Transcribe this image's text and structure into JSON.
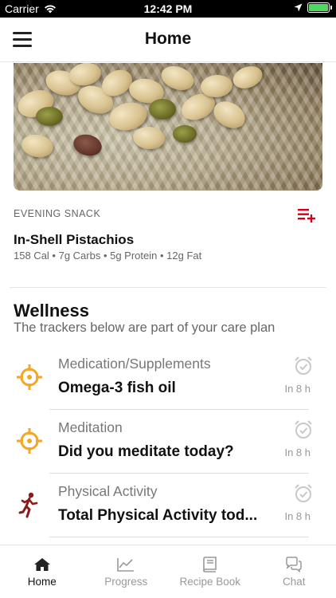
{
  "status_bar": {
    "carrier": "Carrier",
    "time": "12:42 PM",
    "battery_level": 1.0
  },
  "nav": {
    "title": "Home",
    "menu_icon": "hamburger-menu-icon"
  },
  "meal": {
    "type": "EVENING SNACK",
    "name": "In-Shell Pistachios",
    "macros": "158 Cal • 7g Carbs • 5g Protein • 12g Fat",
    "add_icon": "add-to-list-icon",
    "accent_color": "#d0021b"
  },
  "wellness": {
    "title": "Wellness",
    "subtitle": "The trackers below are part of your care plan",
    "trackers": [
      {
        "category": "Medication/Supplements",
        "name": "Omega-3 fish oil",
        "due": "In 8 h",
        "icon": "crosshair-target-icon",
        "icon_color": "#f5a623"
      },
      {
        "category": "Meditation",
        "name": "Did you meditate today?",
        "due": "In 8 h",
        "icon": "crosshair-target-icon",
        "icon_color": "#f5a623"
      },
      {
        "category": "Physical Activity",
        "name": "Total Physical Activity tod...",
        "due": "In 8 h",
        "icon": "running-person-icon",
        "icon_color": "#8b1a1a"
      }
    ]
  },
  "tab_bar": {
    "tabs": [
      {
        "label": "Home",
        "icon": "home-icon",
        "active": true
      },
      {
        "label": "Progress",
        "icon": "line-chart-icon",
        "active": false
      },
      {
        "label": "Recipe Book",
        "icon": "book-icon",
        "active": false
      },
      {
        "label": "Chat",
        "icon": "chat-bubbles-icon",
        "active": false
      }
    ]
  }
}
